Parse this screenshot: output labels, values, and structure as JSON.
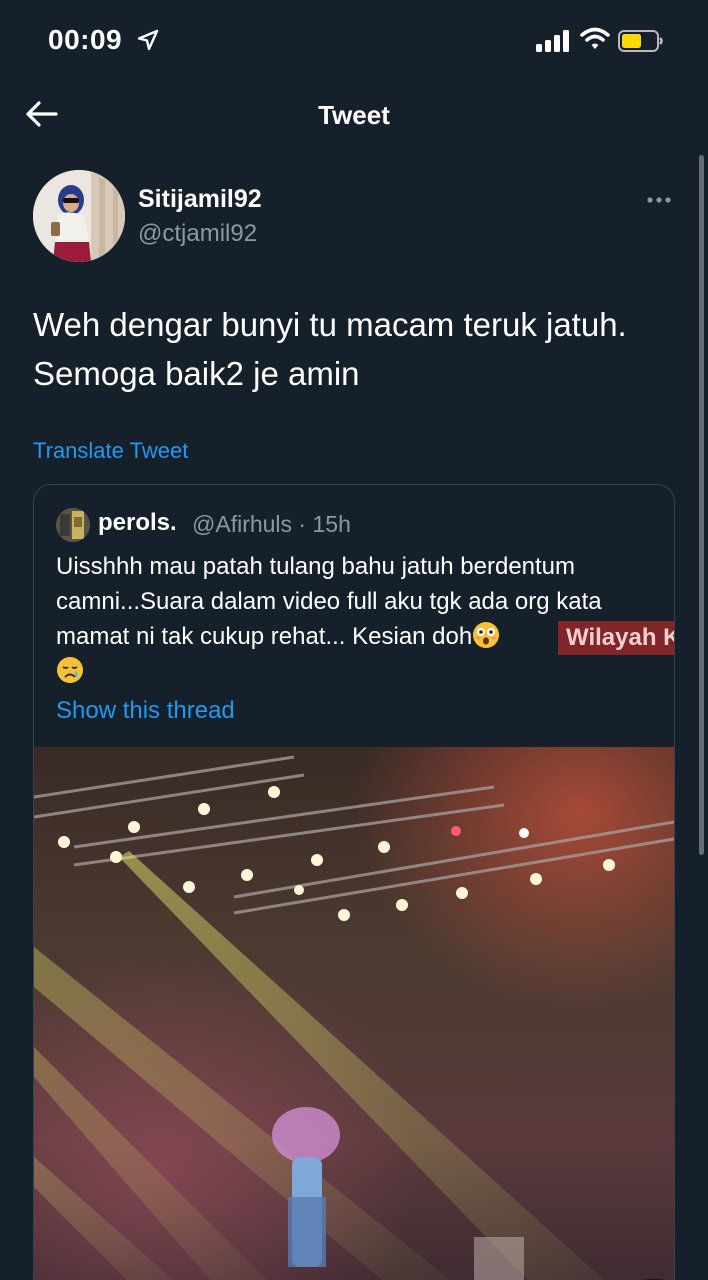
{
  "status_bar": {
    "time": "00:09"
  },
  "nav": {
    "title": "Tweet"
  },
  "tweet": {
    "author_name": "Sitijamil92",
    "author_handle": "@ctjamil92",
    "text": "Weh dengar bunyi tu macam teruk jatuh. Semoga baik2 je amin",
    "translate_label": "Translate Tweet"
  },
  "quote": {
    "author_name": "perols.",
    "handle_time": "@Afirhuls · 15h",
    "text": "Uisshhh mau patah tulang bahu jatuh berdentum camni...Suara dalam video full aku tgk  ada org kata mamat ni tak cukup rehat... Kesian doh",
    "show_thread_label": "Show this thread",
    "watermark": "Wilayah K"
  },
  "colors": {
    "background": "#15202b",
    "accent": "#1d9bf0",
    "muted": "#8b98a5",
    "border": "#38444d"
  }
}
